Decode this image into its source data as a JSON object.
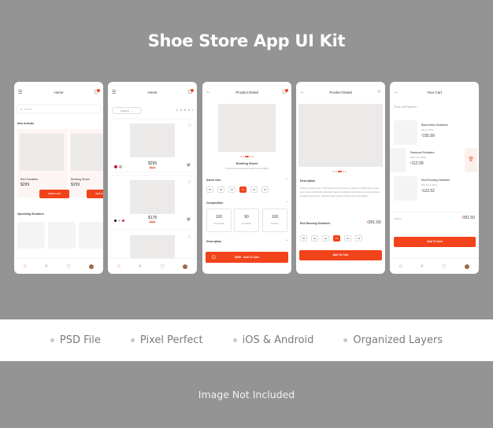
{
  "title": "Shoe Store App UI Kit",
  "features": [
    "PSD File",
    "Pixel Perfect",
    "iOS & Android",
    "Organized Layers"
  ],
  "footer": "Image Not Included",
  "colors": {
    "accent": "#f2431b",
    "background": "#949494",
    "placeholder": "#ece9e9"
  },
  "screen1": {
    "header": "Home",
    "search_placeholder": "Search",
    "new_arrivals": "New Arrivals",
    "products": [
      {
        "name": "Red Sneakers",
        "price": "$299",
        "button": "Add to cart"
      },
      {
        "name": "Running Shoes",
        "price": "$159",
        "button": "Add to cart"
      }
    ],
    "upcoming": "Upcoming Sneakers"
  },
  "screen2": {
    "header": "Home",
    "filter": "Training",
    "pages": [
      "1",
      "2",
      "3",
      "4"
    ],
    "products": [
      {
        "price": "$299",
        "old_price": "$400",
        "colors": [
          "#c0173a",
          "#d3a89a"
        ]
      },
      {
        "price": "$178",
        "old_price": "$350",
        "colors": [
          "#111111",
          "#d0d0d0",
          "#e0245e"
        ]
      }
    ]
  },
  "screen3": {
    "header": "Product Detail",
    "product_name": "Running Shoes",
    "subtitle": "Ut fermentum placerat ipsum nec fringilla",
    "select_size": "Select Size",
    "sizes": [
      "35",
      "39",
      "40",
      "41",
      "42",
      "43"
    ],
    "selected_size": "41",
    "composition_label": "Composition",
    "composition": [
      {
        "value": "100",
        "label": "Polyamide"
      },
      {
        "value": "90",
        "label": "Synthetic"
      },
      {
        "value": "100",
        "label": "Rubber"
      }
    ],
    "description_label": "Description",
    "cart_button": "$300 - Add To Cart"
  },
  "screen4": {
    "header": "Product Detail",
    "description_label": "Description",
    "description": "Nulla eu tempor tortor. Sed iaculis sit amet purus eu pharetra. Maecenas eu risus sem. Fusce sollicitudin sollicitudin sapien. Curabitur vitae lectus nec lectus aliquet blandit id quis ipsum. Vivamus luctus pharet pulvinar velit quis blandit.",
    "product_name": "Red Running Sneakers",
    "price": "391.50",
    "sizes": [
      "35",
      "39",
      "40",
      "41",
      "42",
      "43"
    ],
    "selected_size": "41",
    "button": "Add To Cart"
  },
  "screen5": {
    "header": "Your Cart",
    "subtitle": "Check and Payment",
    "items": [
      {
        "name": "Black Mens Sneakers",
        "type": "Men's Shoe",
        "price": "155.99"
      },
      {
        "name": "Seasonal Sneakers",
        "type": "Women's Shoe",
        "price": "112.99"
      },
      {
        "name": "Red Running Sneakers",
        "type": "Women's Shoe",
        "price": "122.52"
      }
    ],
    "items_count": "3 items",
    "total": "391.50",
    "button": "Add To Cart"
  }
}
